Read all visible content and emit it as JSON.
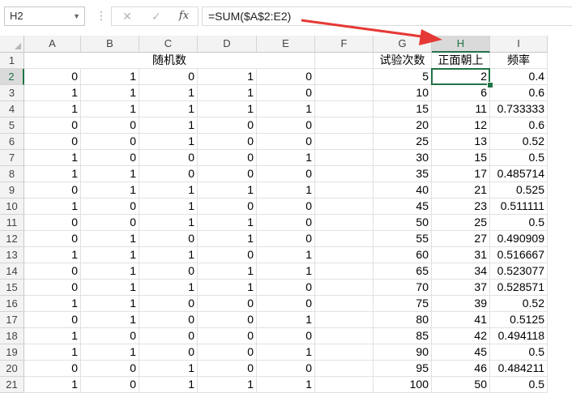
{
  "formula_bar": {
    "name_box": "H2",
    "cancel_icon": "✕",
    "enter_icon": "✓",
    "fx_label": "fx",
    "formula": "=SUM($A$2:E2)"
  },
  "columns": [
    "A",
    "B",
    "C",
    "D",
    "E",
    "F",
    "G",
    "H",
    "I"
  ],
  "selected_column": "H",
  "selected_row": "2",
  "rows": [
    "1",
    "2",
    "3",
    "4",
    "5",
    "6",
    "7",
    "8",
    "9",
    "10",
    "11",
    "12",
    "13",
    "14",
    "15",
    "16",
    "17",
    "18",
    "19",
    "20",
    "21"
  ],
  "header_row": {
    "merged_title": "随机数",
    "g": "试验次数",
    "h": "正面朝上",
    "i": "频率"
  },
  "data": [
    [
      "0",
      "1",
      "0",
      "1",
      "0",
      "",
      "5",
      "2",
      "0.4"
    ],
    [
      "1",
      "1",
      "1",
      "1",
      "0",
      "",
      "10",
      "6",
      "0.6"
    ],
    [
      "1",
      "1",
      "1",
      "1",
      "1",
      "",
      "15",
      "11",
      "0.733333"
    ],
    [
      "0",
      "0",
      "1",
      "0",
      "0",
      "",
      "20",
      "12",
      "0.6"
    ],
    [
      "0",
      "0",
      "1",
      "0",
      "0",
      "",
      "25",
      "13",
      "0.52"
    ],
    [
      "1",
      "0",
      "0",
      "0",
      "1",
      "",
      "30",
      "15",
      "0.5"
    ],
    [
      "1",
      "1",
      "0",
      "0",
      "0",
      "",
      "35",
      "17",
      "0.485714"
    ],
    [
      "0",
      "1",
      "1",
      "1",
      "1",
      "",
      "40",
      "21",
      "0.525"
    ],
    [
      "1",
      "0",
      "1",
      "0",
      "0",
      "",
      "45",
      "23",
      "0.511111"
    ],
    [
      "0",
      "0",
      "1",
      "1",
      "0",
      "",
      "50",
      "25",
      "0.5"
    ],
    [
      "0",
      "1",
      "0",
      "1",
      "0",
      "",
      "55",
      "27",
      "0.490909"
    ],
    [
      "1",
      "1",
      "1",
      "0",
      "1",
      "",
      "60",
      "31",
      "0.516667"
    ],
    [
      "0",
      "1",
      "0",
      "1",
      "1",
      "",
      "65",
      "34",
      "0.523077"
    ],
    [
      "0",
      "1",
      "1",
      "1",
      "0",
      "",
      "70",
      "37",
      "0.528571"
    ],
    [
      "1",
      "1",
      "0",
      "0",
      "0",
      "",
      "75",
      "39",
      "0.52"
    ],
    [
      "0",
      "1",
      "0",
      "0",
      "1",
      "",
      "80",
      "41",
      "0.5125"
    ],
    [
      "1",
      "0",
      "0",
      "0",
      "0",
      "",
      "85",
      "42",
      "0.494118"
    ],
    [
      "1",
      "1",
      "0",
      "0",
      "1",
      "",
      "90",
      "45",
      "0.5"
    ],
    [
      "0",
      "0",
      "1",
      "0",
      "0",
      "",
      "95",
      "46",
      "0.484211"
    ],
    [
      "1",
      "0",
      "1",
      "1",
      "1",
      "",
      "100",
      "50",
      "0.5"
    ]
  ],
  "colors": {
    "accent": "#217346",
    "annotation_arrow": "#e53935"
  }
}
